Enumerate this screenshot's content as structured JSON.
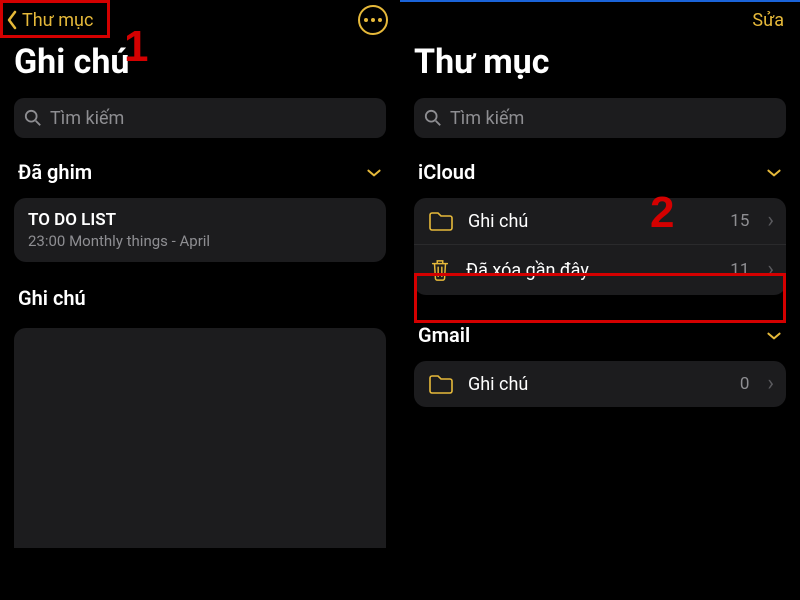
{
  "left": {
    "back_label": "Thư mục",
    "title": "Ghi chú",
    "search_placeholder": "Tìm kiếm",
    "pinned_header": "Đã ghim",
    "note": {
      "title": "TO DO LIST",
      "subtitle": "23:00  Monthly things - April"
    },
    "notes_header": "Ghi chú"
  },
  "right": {
    "edit_label": "Sửa",
    "title": "Thư mục",
    "search_placeholder": "Tìm kiếm",
    "sections": {
      "icloud": {
        "header": "iCloud",
        "folders": [
          {
            "label": "Ghi chú",
            "count": "15",
            "icon": "folder"
          },
          {
            "label": "Đã xóa gần đây",
            "count": "11",
            "icon": "trash"
          }
        ]
      },
      "gmail": {
        "header": "Gmail",
        "folders": [
          {
            "label": "Ghi chú",
            "count": "0",
            "icon": "folder"
          }
        ]
      }
    }
  },
  "annotations": {
    "step1": "1",
    "step2": "2"
  }
}
